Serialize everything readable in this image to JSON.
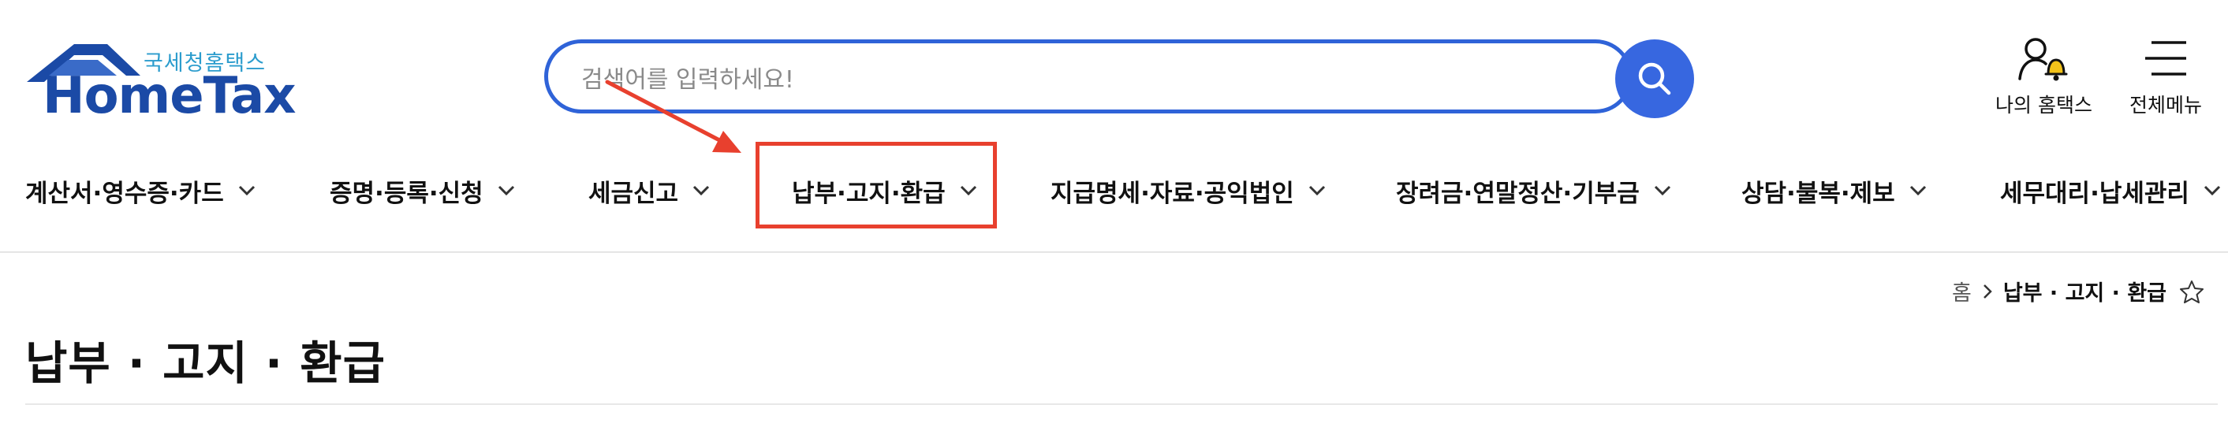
{
  "logo": {
    "tagline": "국세청홈택스",
    "wordmark": "HomeTax"
  },
  "search": {
    "placeholder": "검색어를 입력하세요!"
  },
  "utility": {
    "my_hometax": "나의 홈택스",
    "all_menu": "전체메뉴"
  },
  "gnb": {
    "items": [
      {
        "label": "계산서·영수증·카드"
      },
      {
        "label": "증명·등록·신청"
      },
      {
        "label": "세금신고"
      },
      {
        "label": "납부·고지·환급"
      },
      {
        "label": "지급명세·자료·공익법인"
      },
      {
        "label": "장려금·연말정산·기부금"
      },
      {
        "label": "상담·불복·제보"
      },
      {
        "label": "세무대리·납세관리"
      }
    ]
  },
  "breadcrumb": {
    "home": "홈",
    "current": "납부 · 고지 · 환급"
  },
  "page": {
    "title": "납부 · 고지 · 환급"
  },
  "colors": {
    "brand": "#1b4aa6",
    "search": "#3767e0",
    "highlight": "#e8402e",
    "tagline": "#2b9ccd"
  }
}
